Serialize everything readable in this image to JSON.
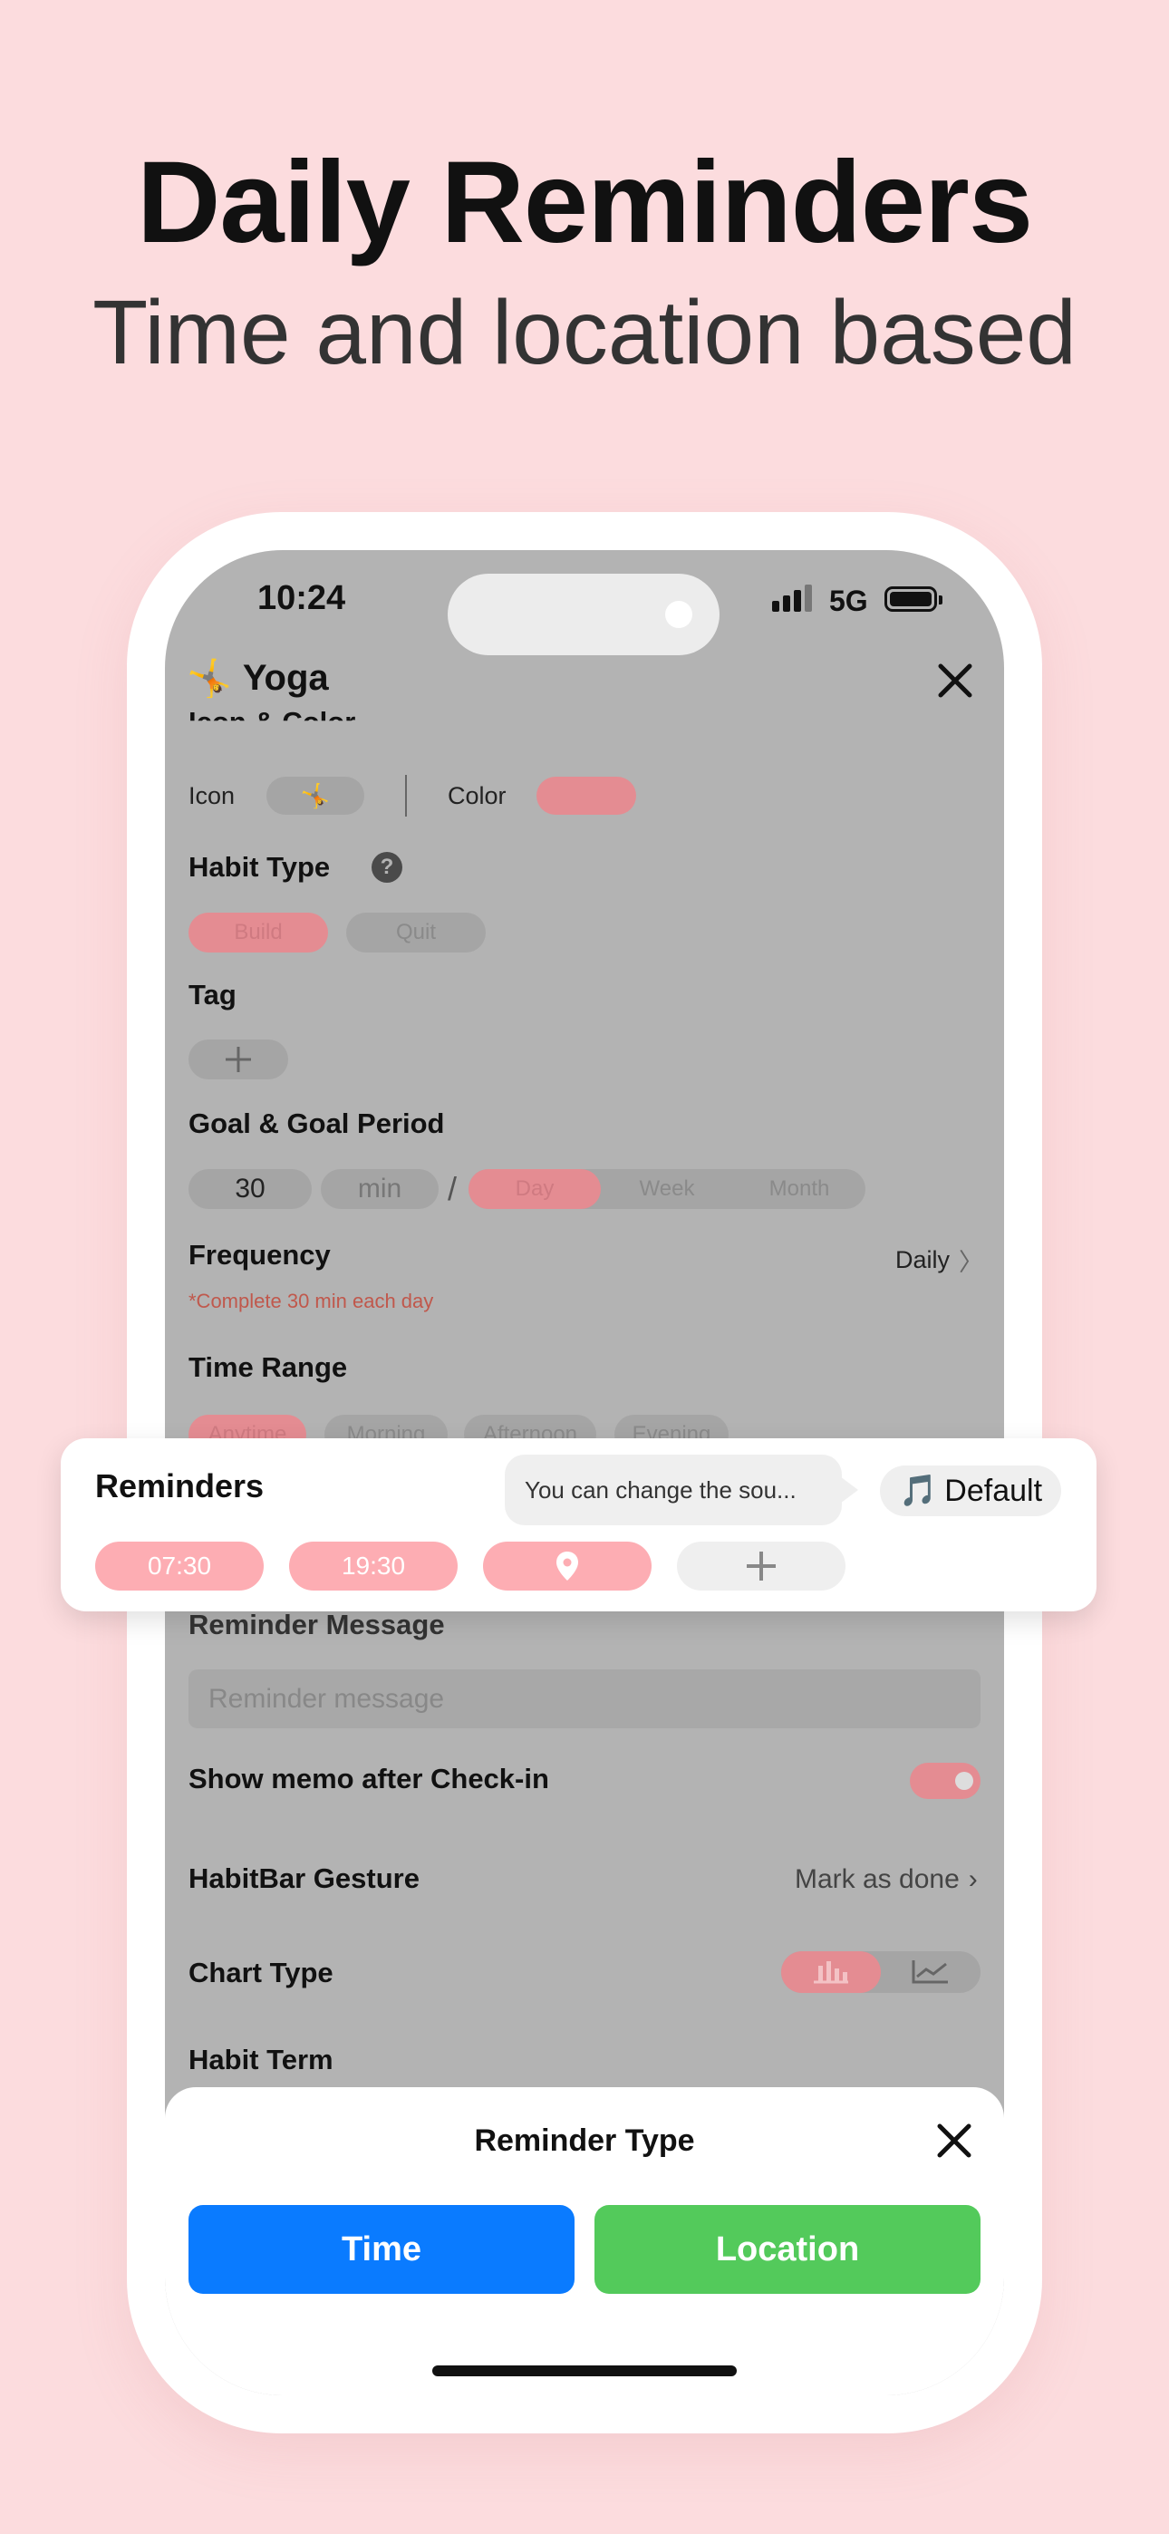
{
  "headline": {
    "title": "Daily Reminders",
    "subtitle": "Time and location based"
  },
  "status_bar": {
    "time": "10:24",
    "network": "5G"
  },
  "nav": {
    "emoji": "🤸",
    "title": "Yoga"
  },
  "form": {
    "icon_color_section": "Icon & Color",
    "icon_label": "Icon",
    "icon_emoji": "🤸",
    "color_label": "Color",
    "habit_type_label": "Habit Type",
    "help_glyph": "?",
    "habit_types": [
      "Build",
      "Quit"
    ],
    "tag_label": "Tag",
    "goal_label": "Goal & Goal Period",
    "goal_value": "30",
    "goal_unit": "min",
    "goal_slash": "/",
    "periods": [
      "Day",
      "Week",
      "Month"
    ],
    "frequency_label": "Frequency",
    "frequency_value": "Daily",
    "frequency_note": "*Complete 30 min each day",
    "time_range_label": "Time Range",
    "time_ranges": [
      "Anytime",
      "Morning",
      "Afternoon",
      "Evening"
    ],
    "reminder_message_label": "Reminder Message",
    "reminder_message_placeholder": "Reminder message",
    "show_memo_label": "Show memo after Check-in",
    "show_memo_on": true,
    "gesture_label": "HabitBar Gesture",
    "gesture_value": "Mark as done",
    "chart_type_label": "Chart Type",
    "habit_term_label": "Habit Term"
  },
  "reminders_card": {
    "title": "Reminders",
    "tooltip": "You can change the sou...",
    "sound_icon": "🎵",
    "sound_label": "Default",
    "times": [
      "07:30",
      "19:30"
    ]
  },
  "sheet": {
    "title": "Reminder Type",
    "time_button": "Time",
    "location_button": "Location"
  },
  "colors": {
    "background": "#fcdcde",
    "accent_pink": "#fdadb3",
    "time_blue": "#0a7bff",
    "location_green": "#53ca5b"
  }
}
